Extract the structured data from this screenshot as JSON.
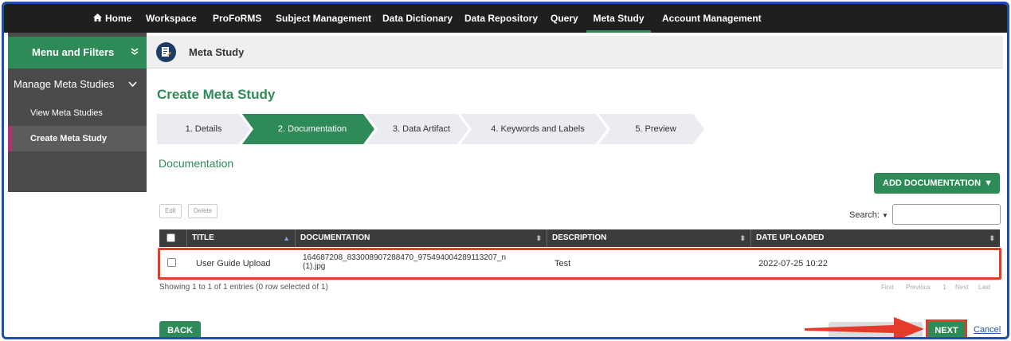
{
  "topnav": {
    "home": "Home",
    "items": [
      "Workspace",
      "ProFoRMS",
      "Subject Management",
      "Data Dictionary",
      "Data Repository",
      "Query",
      "Meta Study",
      "Account Management"
    ]
  },
  "sidebar": {
    "menu_filters": "Menu and Filters",
    "manage": "Manage Meta Studies",
    "items": [
      "View Meta Studies",
      "Create Meta Study"
    ]
  },
  "page_header": {
    "title": "Meta Study"
  },
  "main": {
    "title": "Create Meta Study",
    "steps": [
      "1. Details",
      "2. Documentation",
      "3. Data Artifact",
      "4. Keywords and Labels",
      "5. Preview"
    ],
    "section_heading": "Documentation",
    "add_button": "ADD DOCUMENTATION",
    "edit_button": "Edit",
    "delete_button": "Delete",
    "search_label": "Search:"
  },
  "table": {
    "columns": [
      "TITLE",
      "DOCUMENTATION",
      "DESCRIPTION",
      "DATE UPLOADED"
    ],
    "rows": [
      {
        "title": "User Guide Upload",
        "documentation_line1": "164687208_833008907288470_975494004289113207_n",
        "documentation_line2": "(1).jpg",
        "description": "Test",
        "date_uploaded": "2022-07-25 10:22"
      }
    ],
    "showing": "Showing 1 to 1 of 1 entries (0 row selected of 1)",
    "pager": {
      "first": "First",
      "previous": "Previous",
      "page": "1",
      "next": "Next",
      "last": "Last"
    }
  },
  "footer": {
    "back": "BACK",
    "next": "NEXT",
    "cancel": "Cancel"
  },
  "colors": {
    "accent": "#2e8b57",
    "highlight": "#e53b2c",
    "nav_bg": "#1f1f1f"
  }
}
